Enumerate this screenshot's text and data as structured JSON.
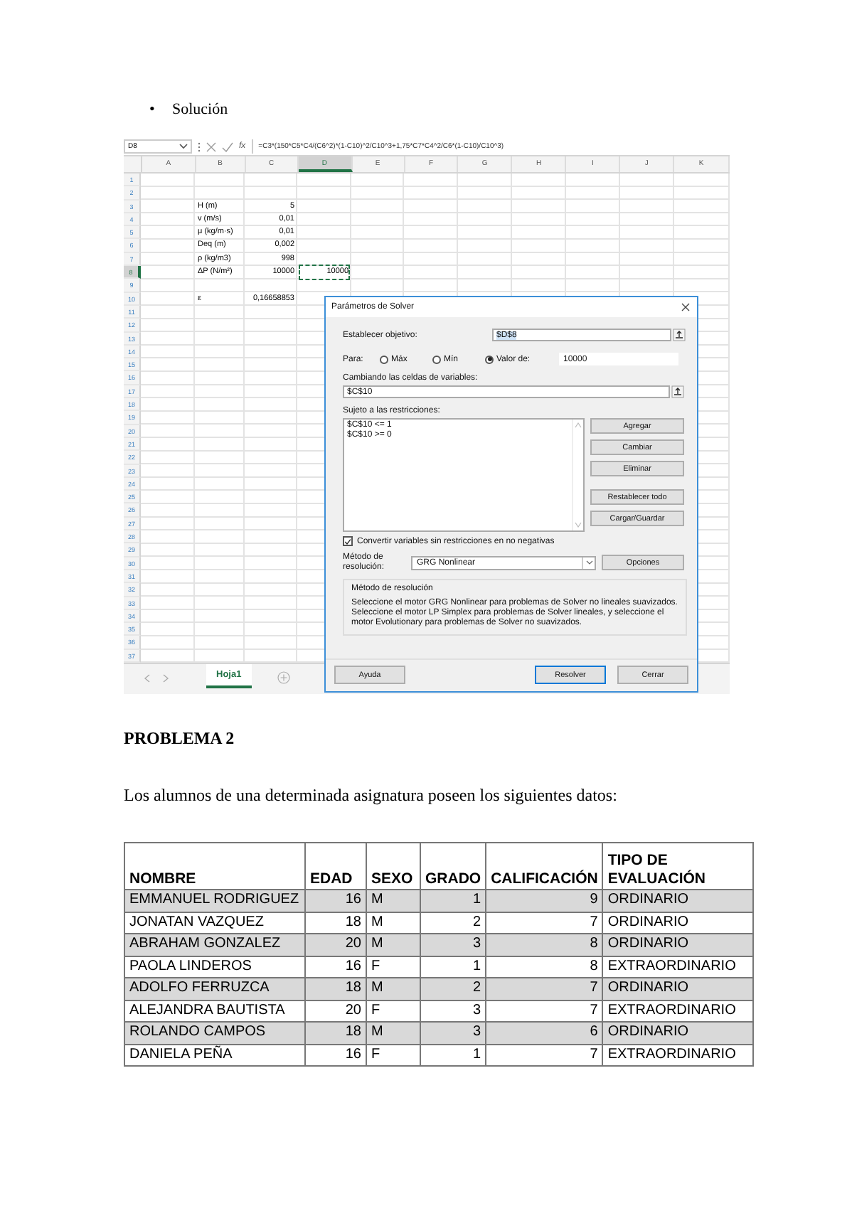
{
  "intro": {
    "bullet": "•",
    "text": "Solución"
  },
  "excel": {
    "name_box": "D8",
    "fx": "fx",
    "formula": "=C3*(150*C5*C4/(C6^2)*(1-C10)^2/C10^3+1,75*C7*C4^2/C6*(1-C10)/C10^3)",
    "columns": [
      {
        "label": "A",
        "selected": false
      },
      {
        "label": "B",
        "selected": false
      },
      {
        "label": "C",
        "selected": false
      },
      {
        "label": "D",
        "selected": true
      },
      {
        "label": "E",
        "selected": false
      },
      {
        "label": "F",
        "selected": false
      },
      {
        "label": "G",
        "selected": false
      },
      {
        "label": "H",
        "selected": false
      },
      {
        "label": "I",
        "selected": false
      },
      {
        "label": "J",
        "selected": false
      },
      {
        "label": "K",
        "selected": false
      }
    ],
    "rows": [
      {
        "number": "1",
        "selected": false,
        "cells": {}
      },
      {
        "number": "2",
        "selected": false,
        "cells": {}
      },
      {
        "number": "3",
        "selected": false,
        "cells": {
          "B": "H (m)",
          "C": "5"
        }
      },
      {
        "number": "4",
        "selected": false,
        "cells": {
          "B": "v (m/s)",
          "C": "0,01"
        }
      },
      {
        "number": "5",
        "selected": false,
        "cells": {
          "B": "μ (kg/m·s)",
          "C": "0,01"
        }
      },
      {
        "number": "6",
        "selected": false,
        "cells": {
          "B": "Deq (m)",
          "C": "0,002"
        }
      },
      {
        "number": "7",
        "selected": false,
        "cells": {
          "B": "ρ (kg/m3)",
          "C": "998"
        }
      },
      {
        "number": "8",
        "selected": true,
        "cells": {
          "B": "ΔP (N/m²)",
          "C": "10000",
          "D": "10000"
        }
      },
      {
        "number": "9",
        "selected": false,
        "cells": {}
      },
      {
        "number": "10",
        "selected": false,
        "cells": {
          "B": "ε",
          "C": "0,16658853"
        }
      },
      {
        "number": "11",
        "selected": false,
        "cells": []
      },
      {
        "number": "12",
        "selected": false,
        "cells": []
      },
      {
        "number": "13",
        "selected": false,
        "cells": []
      },
      {
        "number": "14",
        "selected": false,
        "cells": []
      },
      {
        "number": "15",
        "selected": false,
        "cells": []
      },
      {
        "number": "16",
        "selected": false,
        "cells": []
      },
      {
        "number": "17",
        "selected": false,
        "cells": []
      },
      {
        "number": "18",
        "selected": false,
        "cells": []
      },
      {
        "number": "19",
        "selected": false,
        "cells": []
      },
      {
        "number": "20",
        "selected": false,
        "cells": []
      },
      {
        "number": "21",
        "selected": false,
        "cells": []
      },
      {
        "number": "22",
        "selected": false,
        "cells": []
      },
      {
        "number": "23",
        "selected": false,
        "cells": []
      },
      {
        "number": "24",
        "selected": false,
        "cells": []
      },
      {
        "number": "25",
        "selected": false,
        "cells": []
      },
      {
        "number": "26",
        "selected": false,
        "cells": []
      },
      {
        "number": "27",
        "selected": false,
        "cells": []
      },
      {
        "number": "28",
        "selected": false,
        "cells": []
      },
      {
        "number": "29",
        "selected": false,
        "cells": []
      },
      {
        "number": "30",
        "selected": false,
        "cells": []
      },
      {
        "number": "31",
        "selected": false,
        "cells": []
      },
      {
        "number": "32",
        "selected": false,
        "cells": []
      },
      {
        "number": "33",
        "selected": false,
        "cells": []
      },
      {
        "number": "34",
        "selected": false,
        "cells": []
      },
      {
        "number": "35",
        "selected": false,
        "cells": []
      },
      {
        "number": "36",
        "selected": false,
        "cells": []
      },
      {
        "number": "37",
        "selected": false,
        "cells": []
      }
    ],
    "sheet_tabs": [
      {
        "label": "Hoja1",
        "selected": true
      }
    ],
    "dialog": {
      "title": "Parámetros de Solver",
      "objective_label": "Establecer objetivo:",
      "objective": "$D$8",
      "to_label": "Para:",
      "options": [
        {
          "label": "Máx",
          "selected": false
        },
        {
          "label": "Mín",
          "selected": false
        },
        {
          "label": "Valor de:",
          "selected": true
        }
      ],
      "target_value": "10000",
      "variables_label": "Cambiando las celdas de variables:",
      "variables": "$C$10",
      "constraints_label": "Sujeto a las restricciones:",
      "constraints": [
        "$C$10 <= 1",
        "$C$10 >= 0"
      ],
      "side_buttons": [
        "Agregar",
        "Cambiar",
        "Eliminar",
        "Restablecer todo",
        "Cargar/Guardar"
      ],
      "nonneg": {
        "label": "Convertir variables sin restricciones en no negativas",
        "checked": true
      },
      "method_label": "Método de resolución:",
      "method": "GRG Nonlinear",
      "options_button": "Opciones",
      "group_title": "Método de resolución",
      "description": "Seleccione el motor GRG Nonlinear para problemas de Solver no lineales suavizados. Seleccione el motor LP Simplex para problemas de Solver lineales, y seleccione el motor Evolutionary para problemas de Solver no suavizados.",
      "buttons": [
        {
          "label": "Ayuda",
          "default": false
        },
        {
          "label": "Resolver",
          "default": true
        },
        {
          "label": "Cerrar",
          "default": false
        }
      ]
    }
  },
  "problem": {
    "heading": "PROBLEMA 2",
    "text": "Los alumnos de una determinada asignatura poseen los siguientes datos:",
    "table": {
      "columns": [
        "NOMBRE",
        "EDAD",
        "SEXO",
        "GRADO",
        "CALIFICACIÓN",
        "TIPO DE EVALUACIÓN"
      ],
      "rows": [
        [
          "EMMANUEL RODRIGUEZ",
          "16",
          "M",
          "1",
          "9",
          "ORDINARIO"
        ],
        [
          "JONATAN VAZQUEZ",
          "18",
          "M",
          "2",
          "7",
          "ORDINARIO"
        ],
        [
          "ABRAHAM GONZALEZ",
          "20",
          "M",
          "3",
          "8",
          "ORDINARIO"
        ],
        [
          "PAOLA LINDEROS",
          "16",
          "F",
          "1",
          "8",
          "EXTRAORDINARIO"
        ],
        [
          "ADOLFO FERRUZCA",
          "18",
          "M",
          "2",
          "7",
          "ORDINARIO"
        ],
        [
          "ALEJANDRA BAUTISTA",
          "20",
          "F",
          "3",
          "7",
          "EXTRAORDINARIO"
        ],
        [
          "ROLANDO CAMPOS",
          "18",
          "M",
          "3",
          "6",
          "ORDINARIO"
        ],
        [
          "DANIELA PEÑA",
          "16",
          "F",
          "1",
          "7",
          "EXTRAORDINARIO"
        ]
      ]
    }
  }
}
